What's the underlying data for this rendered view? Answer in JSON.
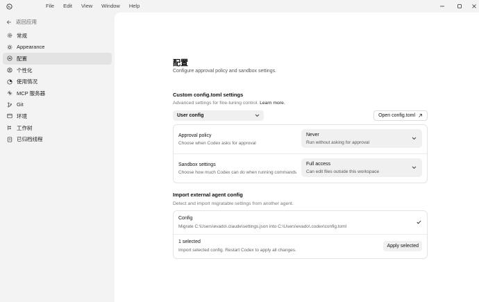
{
  "menu": [
    "File",
    "Edit",
    "View",
    "Window",
    "Help"
  ],
  "sidebar": {
    "back_label": "返回应用",
    "items": [
      {
        "label": "常规",
        "icon": "gear-icon"
      },
      {
        "label": "Appearance",
        "icon": "sun-icon"
      },
      {
        "label": "配置",
        "icon": "config-icon",
        "active": true
      },
      {
        "label": "个性化",
        "icon": "personalize-icon"
      },
      {
        "label": "使用情况",
        "icon": "usage-icon"
      },
      {
        "label": "MCP 服务器",
        "icon": "mcp-icon"
      },
      {
        "label": "Git",
        "icon": "git-icon"
      },
      {
        "label": "环境",
        "icon": "environment-icon"
      },
      {
        "label": "工作树",
        "icon": "worktree-icon"
      },
      {
        "label": "已归档线程",
        "icon": "archive-icon"
      }
    ]
  },
  "page": {
    "title": "配置",
    "subtitle": "Configure approval policy and sandbox settings."
  },
  "custom": {
    "title": "Custom config.toml settings",
    "subtitle": "Advanced settings for fine-tuning control.",
    "learn_more": "Learn more.",
    "select_value": "User config",
    "open_button": "Open config.toml",
    "rows": [
      {
        "label": "Approval policy",
        "desc": "Choose when Codex asks for approval",
        "value": "Never",
        "value_desc": "Run without asking for approval"
      },
      {
        "label": "Sandbox settings",
        "desc": "Choose how much Codex can do when running commands",
        "value": "Full access",
        "value_desc": "Can edit files outside this workspace"
      }
    ]
  },
  "import": {
    "title": "Import external agent config",
    "subtitle": "Detect and import migratable settings from another agent.",
    "config_label": "Config",
    "config_desc": "Migrate C:\\Users\\evado\\.claude\\settings.json into C:\\Users\\evado\\.codex\\config.toml",
    "selected_label": "1 selected",
    "selected_desc": "Import selected config. Restart Codex to apply all changes.",
    "apply_button": "Apply selected"
  }
}
